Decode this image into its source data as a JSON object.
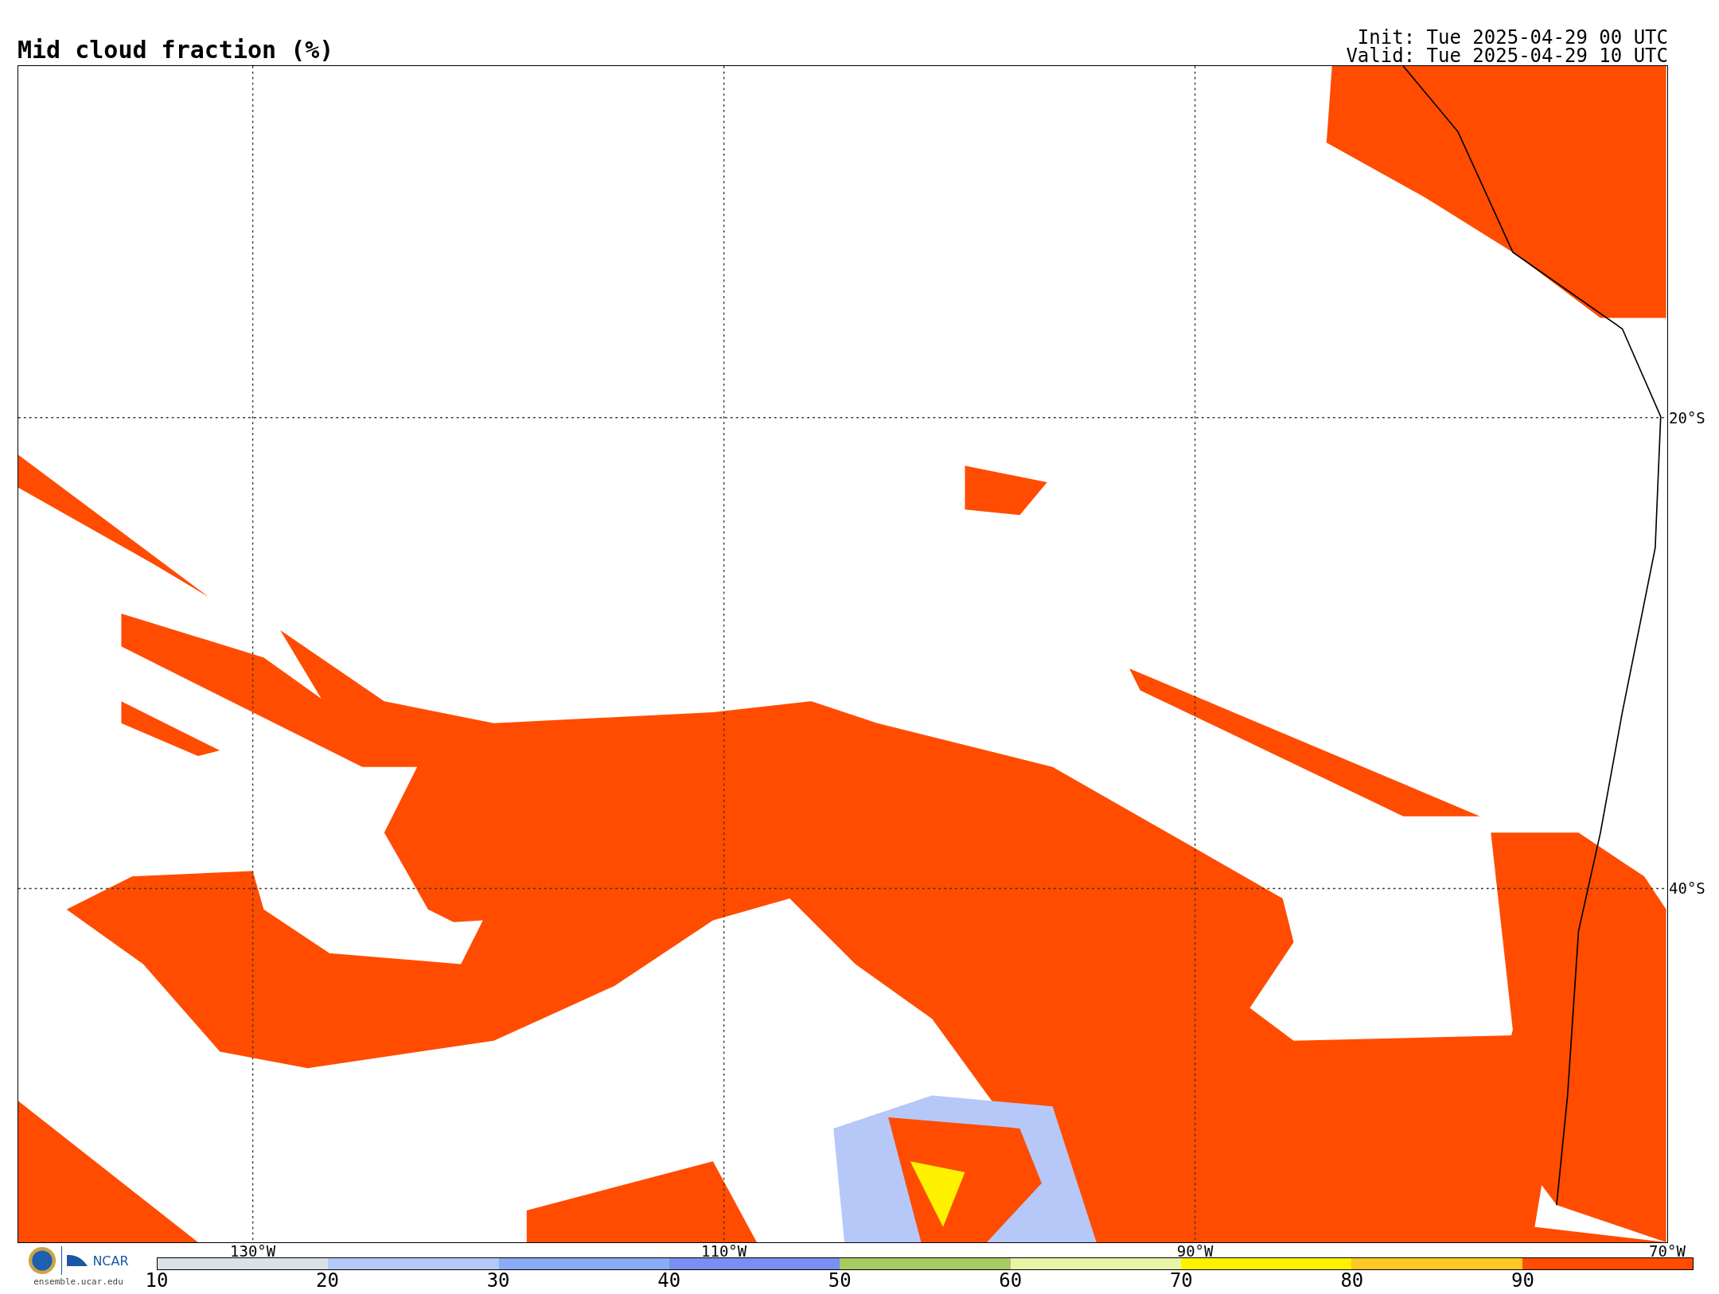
{
  "title": "Mid cloud fraction (%)",
  "run_info": {
    "init": "Init: Tue 2025-04-29 00 UTC",
    "valid": "Valid: Tue 2025-04-29 10 UTC"
  },
  "map": {
    "lon_labels": [
      "130°W",
      "110°W",
      "90°W",
      "70°W"
    ],
    "lat_labels": [
      "20°S",
      "40°S"
    ]
  },
  "branding": {
    "logo_text": "NCAR",
    "site": "ensemble.ucar.edu"
  },
  "colorbar": {
    "bins": [
      {
        "color": "#d8e2ea"
      },
      {
        "color": "#b5c8f8"
      },
      {
        "color": "#8aacf7"
      },
      {
        "color": "#7b8ef3"
      },
      {
        "color": "#a5cc63"
      },
      {
        "color": "#e8f5a8"
      },
      {
        "color": "#fff200"
      },
      {
        "color": "#ffc825"
      },
      {
        "color": "#ff4c00"
      }
    ],
    "tick_labels": [
      "10",
      "20",
      "30",
      "40",
      "50",
      "60",
      "70",
      "80",
      "90"
    ]
  }
}
